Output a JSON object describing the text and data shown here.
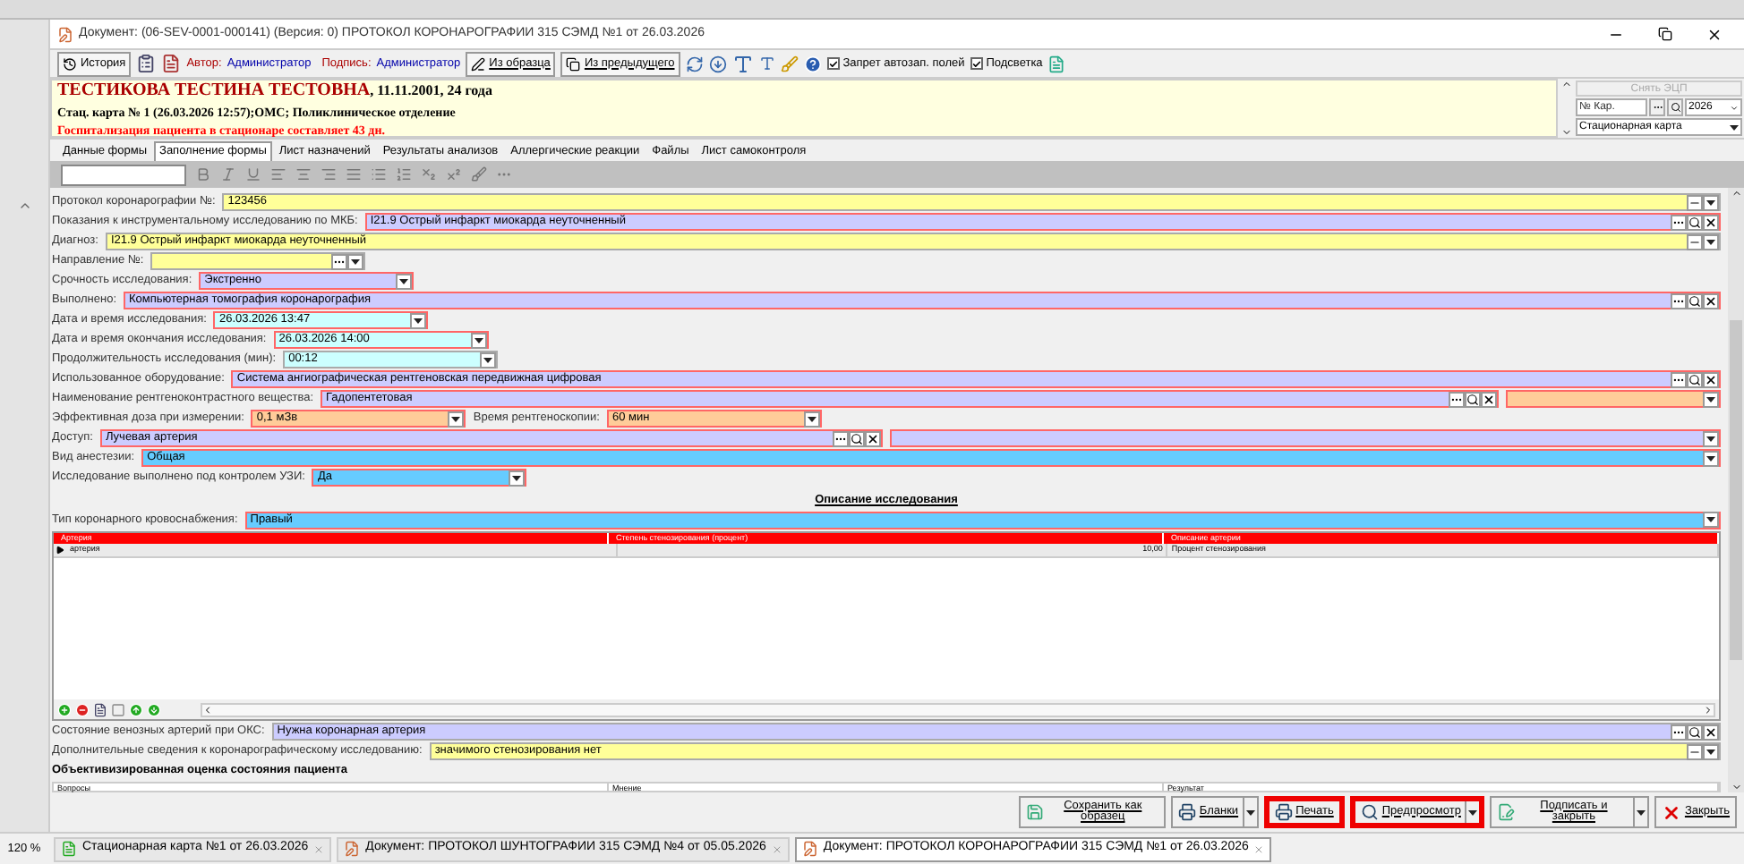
{
  "window": {
    "title": "Документ: (06-SEV-0001-000141) (Версия: 0) ПРОТОКОЛ КОРОНАРОГРАФИИ 315 СЭМД №1 от 26.03.2026"
  },
  "toolbar": {
    "history_button": "История",
    "author_label": "Автор:",
    "author": "Администратор",
    "signature_label": "Подпись:",
    "signer": "Администратор",
    "from_template": "Из образца",
    "from_previous": "Из предыдущего",
    "checkboxes": [
      {
        "label": "Запрет автозап. полей",
        "checked": true
      },
      {
        "label": "Подсветка",
        "checked": true
      }
    ]
  },
  "patient": {
    "name": "ТЕСТИКОВА ТЕСТИНА ТЕСТОВНА",
    "details": ", 11.11.2001, 24 года",
    "card": "Стац. карта  № 1 (26.03.2026 12:57);ОМС; Поликлиническое отделение",
    "warning": "Госпитализация пациента в стационаре составляет 43 дн."
  },
  "card_panel": {
    "sign_button": "Снять ЭЦП",
    "card_number_placeholder": "№ Кар.",
    "year": "2026",
    "card_type": "Стационарная карта"
  },
  "tabs": [
    {
      "label": "Данные формы",
      "selected": false
    },
    {
      "label": "Заполнение формы",
      "selected": true
    },
    {
      "label": "Лист назначений",
      "selected": false
    },
    {
      "label": "Результаты анализов",
      "selected": false
    },
    {
      "label": "Аллергические реакции",
      "selected": false
    },
    {
      "label": "Файлы",
      "selected": false
    },
    {
      "label": "Лист самоконтроля",
      "selected": false
    }
  ],
  "form": {
    "rows": [
      {
        "fields": [
          {
            "label": "Протокол коронарографии №:",
            "value": "123456",
            "color": "#ffff99",
            "required": false,
            "wide": true,
            "kind": "memo"
          }
        ]
      },
      {
        "fields": [
          {
            "label": "Показания к инструментальному исследованию по МКБ:",
            "value": "I21.9 Острый инфаркт миокарда неуточненный",
            "color": "#ccccff",
            "required": true,
            "wide": true,
            "kind": "lookup"
          }
        ]
      },
      {
        "fields": [
          {
            "label": "Диагноз:",
            "value": "I21.9 Острый инфаркт миокарда неуточненный",
            "color": "#ffff99",
            "required": false,
            "wide": true,
            "kind": "memo"
          }
        ]
      },
      {
        "fields": [
          {
            "label": "Направление №:",
            "color": "#ffff99",
            "required": false,
            "wide": false,
            "kind": "reference"
          }
        ]
      },
      {
        "fields": [
          {
            "label": "Срочность исследования:",
            "value": "Экстренно",
            "color": "#ccccff",
            "required": true,
            "wide": false,
            "kind": "dropdown"
          }
        ]
      },
      {
        "fields": [
          {
            "label": "Выполнено:",
            "value": "Компьютерная томография коронарография",
            "color": "#ccccff",
            "required": true,
            "wide": true,
            "kind": "lookup"
          }
        ]
      },
      {
        "fields": [
          {
            "label": "Дата и время исследования:",
            "value": "26.03.2026 13:47",
            "color": "#ccffff",
            "required": true,
            "wide": false,
            "kind": "dropdown"
          }
        ]
      },
      {
        "fields": [
          {
            "label": "Дата и время окончания исследования:",
            "value": "26.03.2026 14:00",
            "color": "#ccffff",
            "required": true,
            "wide": false,
            "kind": "dropdown"
          }
        ]
      },
      {
        "fields": [
          {
            "label": "Продолжительность исследования (мин):",
            "value": "00:12",
            "color": "#ccffff",
            "required": false,
            "wide": false,
            "kind": "dropdown"
          }
        ]
      },
      {
        "fields": [
          {
            "label": "Использованное оборудование:",
            "value": "Система ангиографическая рентгеновская передвижная цифровая",
            "color": "#ccccff",
            "required": true,
            "wide": true,
            "kind": "lookup"
          }
        ]
      },
      {
        "fields": [
          {
            "label": "Наименование рентгеноконтрастного вещества:",
            "value": "Гадопентетовая",
            "color": "#ccccff",
            "required": true,
            "wide": true,
            "kind": "lookup"
          },
          {
            "color": "#ffcc99",
            "required": true,
            "wide": false,
            "kind": "dropdown"
          }
        ]
      },
      {
        "fields": [
          {
            "label": "Эффективная доза при измерении:",
            "value": "0,1 мЗв",
            "color": "#ffcc99",
            "required": true,
            "wide": false,
            "kind": "dropdown"
          },
          {
            "label": "Время рентгеноскопии:",
            "value": "60 мин",
            "color": "#ffcc99",
            "required": true,
            "wide": false,
            "kind": "dropdown"
          }
        ]
      },
      {
        "fields": [
          {
            "label": "Доступ:",
            "value": "Лучевая артерия",
            "color": "#ccccff",
            "required": true,
            "wide": true,
            "kind": "lookup"
          },
          {
            "color": "#ccccff",
            "required": true,
            "wide": true,
            "kind": "dropdown"
          }
        ]
      },
      {
        "fields": [
          {
            "label": "Вид анестезии:",
            "value": "Общая",
            "color": "#66ccff",
            "required": true,
            "wide": true,
            "kind": "dropdown"
          }
        ]
      },
      {
        "fields": [
          {
            "label": "Исследование выполнено под контролем УЗИ:",
            "value": "Да",
            "color": "#66ccff",
            "required": true,
            "wide": false,
            "kind": "dropdown"
          }
        ]
      }
    ],
    "section_title": "Описание исследования",
    "supply": {
      "label": "Тип коронарного кровоснабжения:",
      "value": "Правый",
      "color": "#66ccff",
      "required": true,
      "wide": true,
      "kind": "dropdown"
    },
    "grid": {
      "columns": [
        "Артерия",
        "Степень стенозирования (процент)",
        "Описание артерии"
      ],
      "rows": [
        {
          "selected": true,
          "cells": [
            "артерия",
            "10,00",
            "Процент стенозирования"
          ]
        }
      ]
    },
    "bottom_rows": [
      {
        "label": "Состояние венозных артерий при ОКС:",
        "value": "Нужна коронарная артерия",
        "color": "#ccccff",
        "required": false,
        "wide": true,
        "kind": "lookup"
      },
      {
        "label": "Дополнительные сведения к коронарографическому исследованию:",
        "value": "значимого стенозирования нет",
        "color": "#ffff99",
        "required": false,
        "wide": true,
        "kind": "memo"
      }
    ],
    "assessment": {
      "title": "Объективизированная оценка состояния пациента",
      "columns": [
        "Вопросы",
        "Мнение",
        "Результат"
      ]
    }
  },
  "buttons": [
    {
      "label": "Сохранить как образец",
      "kind": "save",
      "dropdown": false,
      "highlighted": false
    },
    {
      "label": "Бланки",
      "kind": "print",
      "dropdown": true,
      "highlighted": false
    },
    {
      "label": "Печать",
      "kind": "print",
      "dropdown": false,
      "highlighted": true
    },
    {
      "label": "Предпросмотр",
      "kind": "preview",
      "dropdown": true,
      "highlighted": true
    },
    {
      "label": "Подписать и закрыть",
      "kind": "sign",
      "dropdown": true,
      "highlighted": false
    },
    {
      "label": "Закрыть",
      "kind": "close",
      "dropdown": false,
      "highlighted": false
    }
  ],
  "status": {
    "zoom": "120 %"
  },
  "taskbar": [
    {
      "label": "Стационарная карта №1 от 26.03.2026",
      "kind": "card",
      "selected": false
    },
    {
      "label": "Документ: ПРОТОКОЛ ШУНТОГРАФИИ 315 СЭМД №4 от 05.05.2026",
      "kind": "document",
      "selected": false
    },
    {
      "label": "Документ: ПРОТОКОЛ КОРОНАРОГРАФИИ 315 СЭМД №1 от 26.03.2026",
      "kind": "document",
      "selected": true
    }
  ]
}
